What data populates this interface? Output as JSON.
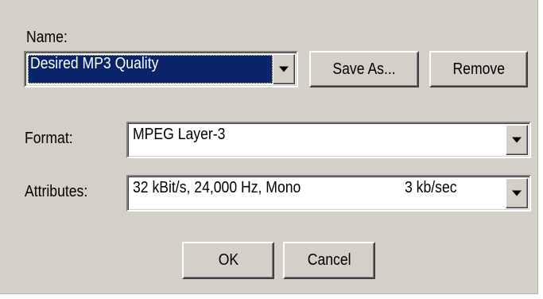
{
  "dialog": {
    "name_label": "Name:",
    "name_value": "Desired MP3 Quality",
    "save_as_label": "Save As...",
    "remove_label": "Remove",
    "format_label": "Format:",
    "format_value": "MPEG Layer-3",
    "attributes_label": "Attributes:",
    "attributes_value": "32 kBit/s, 24,000 Hz, Mono",
    "attributes_rate": "3 kb/sec",
    "ok_label": "OK",
    "cancel_label": "Cancel"
  },
  "colors": {
    "face": "#d4d0c8",
    "selection": "#0a246a"
  },
  "icons": {
    "dropdown": "chevron-down-icon"
  }
}
